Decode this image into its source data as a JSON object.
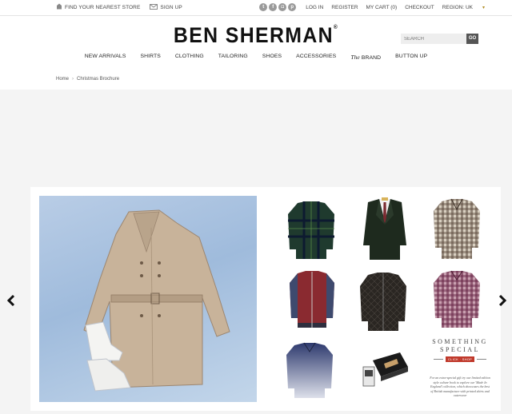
{
  "topbar": {
    "store_finder": "FIND YOUR NEAREST STORE",
    "sign_up": "SIGN UP",
    "social": [
      "t",
      "f",
      "◘",
      "p"
    ],
    "links": [
      "LOG IN",
      "REGISTER",
      "MY CART (0)",
      "CHECKOUT",
      "REGION: UK"
    ]
  },
  "header": {
    "logo": "BEN SHERMAN",
    "logo_mark": "®",
    "search_placeholder": "SEARCH",
    "search_button": "GO"
  },
  "nav": {
    "items": [
      "NEW ARRIVALS",
      "SHIRTS",
      "CLOTHING",
      "TAILORING",
      "SHOES",
      "ACCESSORIES"
    ],
    "brand_prefix": "The",
    "brand_suffix": "BRAND",
    "button_up": "BUTTON UP"
  },
  "breadcrumb": {
    "home": "Home",
    "separator": "›",
    "current": "Christmas Brochure"
  },
  "carousel": {
    "prev": "‹",
    "next": "›"
  },
  "special": {
    "title_line1": "SOMETHING",
    "title_line2": "SPECIAL",
    "click_label": "CLICK · SHOP",
    "description": "For an extra-special gift try our limited edition style culture book to explore our 'Made In England' collection, which showcases the best of British manufacture with printed shirts and outerwear"
  },
  "colors": {
    "background": "#f4f4f4",
    "search_button": "#555555",
    "accent_red": "#c0392b",
    "region_caret": "#b08a20"
  },
  "icons": [
    "store-icon",
    "mail-icon",
    "twitter-icon",
    "facebook-icon",
    "instagram-icon",
    "pinterest-icon",
    "chevron-left-icon",
    "chevron-right-icon"
  ]
}
